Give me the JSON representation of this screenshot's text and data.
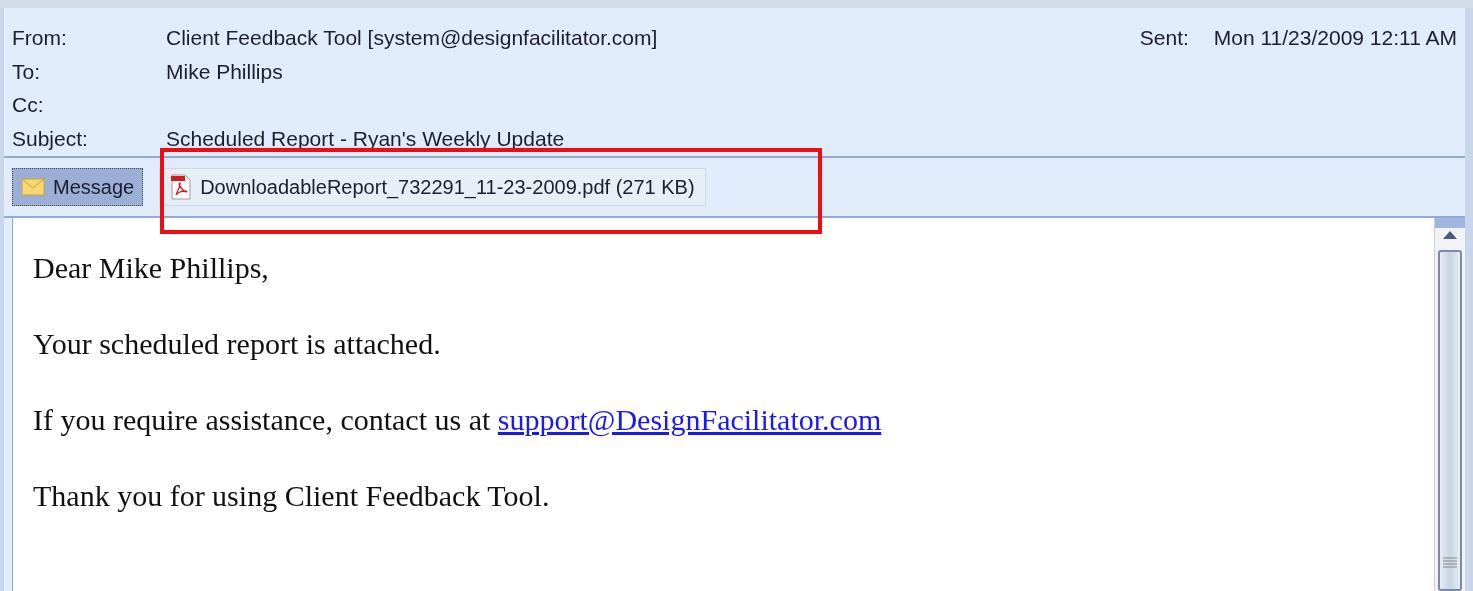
{
  "header": {
    "fields": [
      {
        "label": "From:",
        "value": "Client Feedback Tool [system@designfacilitator.com]"
      },
      {
        "label": "To:",
        "value": "Mike Phillips"
      },
      {
        "label": "Cc:"
      },
      {
        "label": "Subject:",
        "value": "Scheduled Report - Ryan's Weekly Update"
      }
    ],
    "sent": {
      "label": "Sent:",
      "value": "Mon 11/23/2009 12:11 AM"
    }
  },
  "tabs": [
    {
      "kind": "message",
      "label": "Message",
      "selected": true
    },
    {
      "kind": "pdf",
      "label": "DownloadableReport_732291_11-23-2009.pdf (271 KB)",
      "selected": false
    }
  ],
  "body": {
    "paragraphs": [
      {
        "text": "Dear Mike Phillips,"
      },
      {
        "text": "Your scheduled report is attached."
      },
      {
        "text": "If you require assistance, contact us at ",
        "link": "support@DesignFacilitator.com"
      },
      {
        "text": "Thank you for using Client Feedback Tool."
      }
    ]
  }
}
